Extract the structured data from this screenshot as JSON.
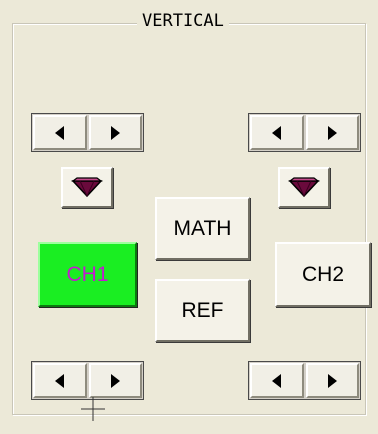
{
  "panel": {
    "title": "VERTICAL"
  },
  "buttons": {
    "math": "MATH",
    "ref": "REF",
    "ch1": "CH1",
    "ch2": "CH2"
  },
  "colors": {
    "ch1_active_bg": "#1aee22",
    "ch1_text": "#c21bd0",
    "gem": "#6a0a3c"
  },
  "icons": {
    "left_arrow": "arrow-left-icon",
    "right_arrow": "arrow-right-icon",
    "dropdown": "gem-dropdown-icon",
    "cursor": "crosshair-cursor-icon"
  }
}
